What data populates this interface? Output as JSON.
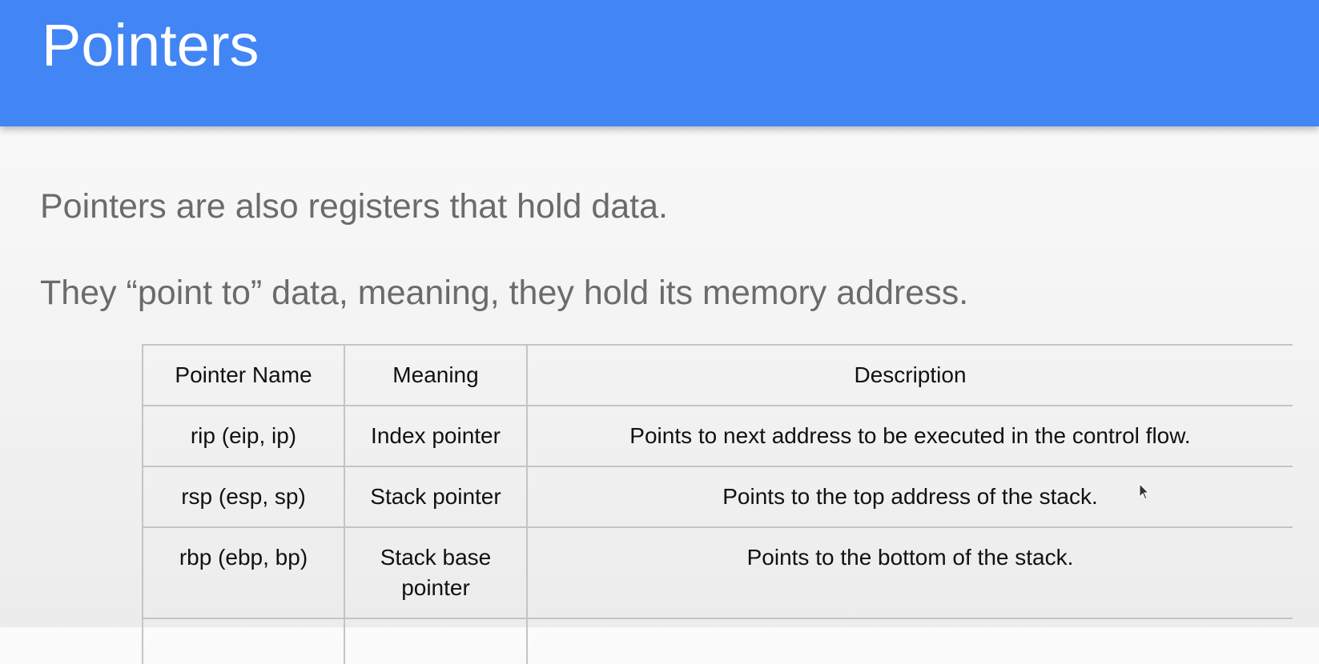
{
  "slide": {
    "title": "Pointers",
    "paragraphs": [
      "Pointers are also registers that hold data.",
      "They “point to” data, meaning, they hold its memory address."
    ]
  },
  "table": {
    "headers": [
      "Pointer Name",
      "Meaning",
      "Description"
    ],
    "rows": [
      [
        "rip (eip, ip)",
        "Index pointer",
        "Points to next address to be executed in the control flow."
      ],
      [
        "rsp (esp, sp)",
        "Stack pointer",
        "Points to the top address of the stack."
      ],
      [
        "rbp (ebp, bp)",
        "Stack base pointer",
        "Points to the bottom of the stack."
      ]
    ]
  },
  "colors": {
    "title_bar": "#4285f4",
    "title_text": "#ffffff",
    "body_text": "#6b6b6b",
    "table_border": "#c4c4c4"
  },
  "icons": {
    "cursor": "mouse-pointer-icon"
  }
}
